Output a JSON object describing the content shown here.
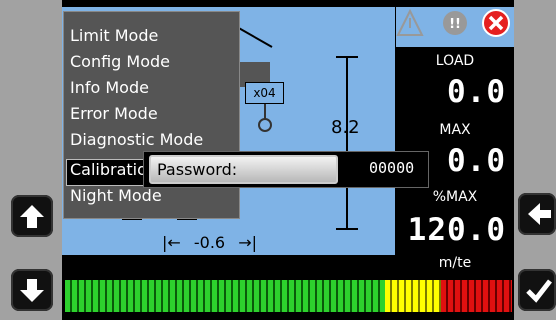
{
  "menu": {
    "items": [
      {
        "label": "Limit Mode"
      },
      {
        "label": "Config Mode"
      },
      {
        "label": "Info Mode"
      },
      {
        "label": "Error Mode"
      },
      {
        "label": "Diagnostic Mode"
      },
      {
        "label": "Calibration"
      },
      {
        "label": "Night Mode"
      }
    ],
    "selected_index": 5
  },
  "dialog": {
    "password_label": "Password:",
    "password_value": "00000"
  },
  "scene": {
    "hook_label": "x04",
    "height_value": "8.2",
    "radius_value": "-0.6"
  },
  "panel": {
    "load_label": "LOAD",
    "load_value": "0.0",
    "max_label": "MAX",
    "max_value": "0.0",
    "pct_max_label": "%MAX",
    "pct_max_value": "120.0",
    "unit_label": "m/te"
  },
  "alerts": [
    "warning-triangle-icon",
    "brake-warning-icon",
    "error-x-icon"
  ],
  "colors": {
    "green": "#2dd12d",
    "yellow": "#ffff00",
    "red": "#e01010",
    "sky": "#7fb3e6"
  },
  "load_bar": {
    "green_fraction": 0.72,
    "yellow_fraction": 0.12,
    "red_fraction": 0.16
  }
}
